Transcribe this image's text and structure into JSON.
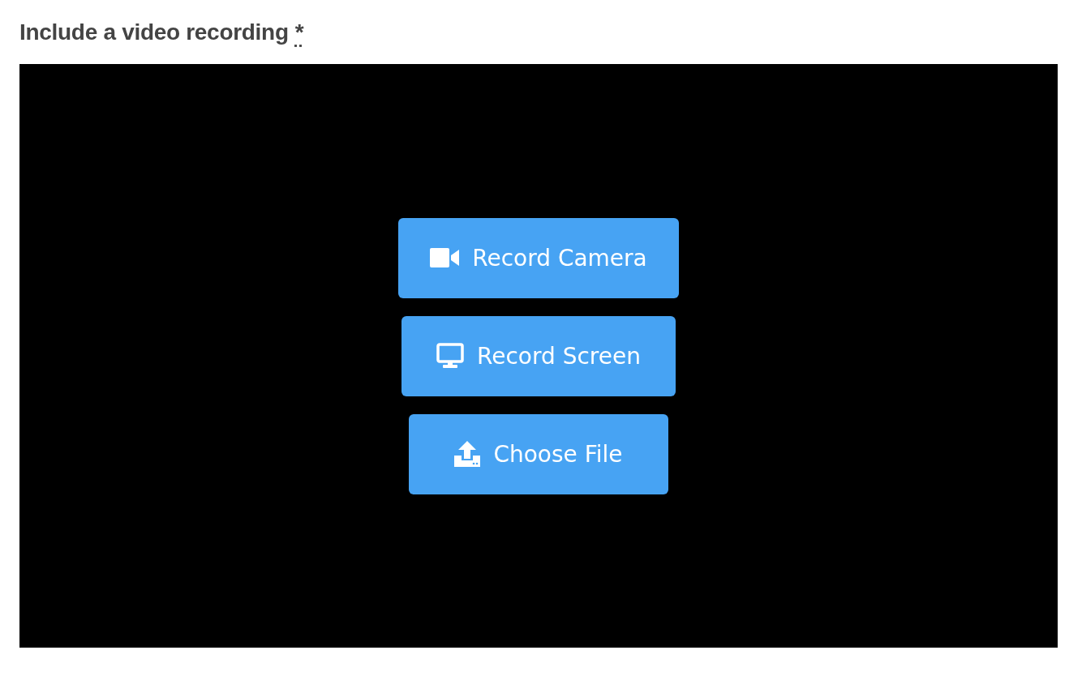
{
  "field": {
    "label": "Include a video recording",
    "required_mark": "*"
  },
  "recorder": {
    "buttons": [
      {
        "kind": "camera",
        "label": "Record Camera"
      },
      {
        "kind": "screen",
        "label": "Record Screen"
      },
      {
        "kind": "upload",
        "label": "Choose File"
      }
    ]
  }
}
